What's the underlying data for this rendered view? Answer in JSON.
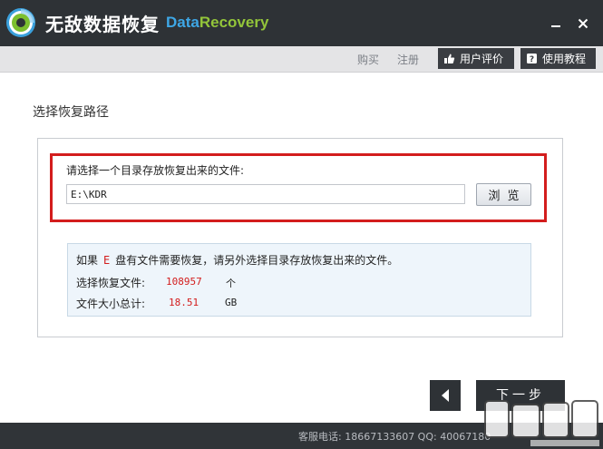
{
  "app": {
    "name_cn": "无敌数据恢复",
    "name_en_part1": "Data",
    "name_en_part2": "Recovery"
  },
  "window_controls": {
    "minimize_icon": "minimize-icon",
    "close_icon": "close-icon"
  },
  "toolbar": {
    "buy_label": "购买",
    "register_label": "注册",
    "review_label": "用户评价",
    "review_icon": "thumbs-up-icon",
    "tutorial_label": "使用教程",
    "tutorial_icon": "help-icon"
  },
  "section_title": "选择恢复路径",
  "path_selector": {
    "label": "请选择一个目录存放恢复出来的文件:",
    "value": "E:\\KDR",
    "browse_label": "浏览"
  },
  "info": {
    "prefix": "如果",
    "drive": "E",
    "suffix": "盘有文件需要恢复，请另外选择目录存放恢复出来的文件。",
    "files_label": "选择恢复文件:",
    "files_value": "108957",
    "files_unit": "个",
    "size_label": "文件大小总计:",
    "size_value": "18.51",
    "size_unit": "GB"
  },
  "navigation": {
    "back_icon": "back-arrow-icon",
    "next_label": "下一步"
  },
  "status": {
    "text": "客服电话: 18667133607  QQ: 40067180"
  },
  "colors": {
    "titlebar": "#2e3236",
    "accent_blue": "#3ea7e6",
    "accent_green": "#93c53a",
    "highlight_red": "#d31d1d"
  }
}
